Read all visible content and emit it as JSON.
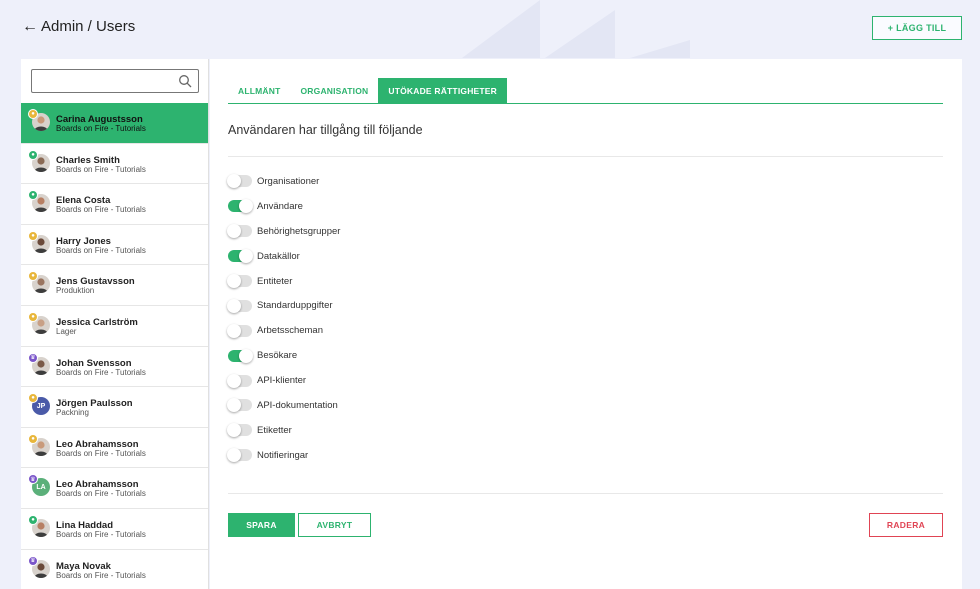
{
  "header": {
    "breadcrumb": "Admin / Users",
    "add_label": "+ LÄGG TILL"
  },
  "search": {
    "placeholder": "",
    "value": ""
  },
  "users": [
    {
      "name": "Carina Augustsson",
      "org": "Boards on Fire - Tutorials",
      "badge": "gold",
      "avatar": "photo",
      "selected": true
    },
    {
      "name": "Charles Smith",
      "org": "Boards on Fire - Tutorials",
      "badge": "green",
      "avatar": "photo",
      "selected": false
    },
    {
      "name": "Elena Costa",
      "org": "Boards on Fire - Tutorials",
      "badge": "green",
      "avatar": "photo",
      "selected": false
    },
    {
      "name": "Harry Jones",
      "org": "Boards on Fire - Tutorials",
      "badge": "gold",
      "avatar": "photo",
      "selected": false
    },
    {
      "name": "Jens Gustavsson",
      "org": "Produktion",
      "badge": "gold",
      "avatar": "photo",
      "selected": false
    },
    {
      "name": "Jessica Carlström",
      "org": "Lager",
      "badge": "gold",
      "avatar": "photo",
      "selected": false
    },
    {
      "name": "Johan Svensson",
      "org": "Boards on Fire - Tutorials",
      "badge": "purple",
      "avatar": "photo",
      "selected": false
    },
    {
      "name": "Jörgen Paulsson",
      "org": "Packning",
      "badge": "gold",
      "avatar": "initials",
      "initials": "JP",
      "selected": false
    },
    {
      "name": "Leo Abrahamsson",
      "org": "Boards on Fire - Tutorials",
      "badge": "gold",
      "avatar": "photo",
      "selected": false
    },
    {
      "name": "Leo Abrahamsson",
      "org": "Boards on Fire - Tutorials",
      "badge": "purple",
      "avatar": "initials",
      "initials": "LA",
      "selected": false
    },
    {
      "name": "Lina Haddad",
      "org": "Boards on Fire - Tutorials",
      "badge": "green",
      "avatar": "photo",
      "selected": false
    },
    {
      "name": "Maya Novak",
      "org": "Boards on Fire - Tutorials",
      "badge": "purple",
      "avatar": "photo",
      "selected": false
    }
  ],
  "tabs": [
    {
      "label": "ALLMÄNT",
      "active": false
    },
    {
      "label": "ORGANISATION",
      "active": false
    },
    {
      "label": "UTÖKADE RÄTTIGHETER",
      "active": true
    }
  ],
  "main": {
    "heading": "Användaren har tillgång till följande",
    "save_label": "SPARA",
    "cancel_label": "AVBRYT",
    "delete_label": "RADERA"
  },
  "permissions": [
    {
      "label": "Organisationer",
      "on": false
    },
    {
      "label": "Användare",
      "on": true
    },
    {
      "label": "Behörighetsgrupper",
      "on": false
    },
    {
      "label": "Datakällor",
      "on": true
    },
    {
      "label": "Entiteter",
      "on": false
    },
    {
      "label": "Standarduppgifter",
      "on": false
    },
    {
      "label": "Arbetsscheman",
      "on": false
    },
    {
      "label": "Besökare",
      "on": true
    },
    {
      "label": "API-klienter",
      "on": false
    },
    {
      "label": "API-dokumentation",
      "on": false
    },
    {
      "label": "Etiketter",
      "on": false
    },
    {
      "label": "Notifieringar",
      "on": false
    }
  ],
  "colors": {
    "accent": "#2db36f",
    "danger": "#e04454",
    "badge_gold": "#e8b63a",
    "badge_green": "#2db36f",
    "badge_purple": "#7a55c9"
  }
}
